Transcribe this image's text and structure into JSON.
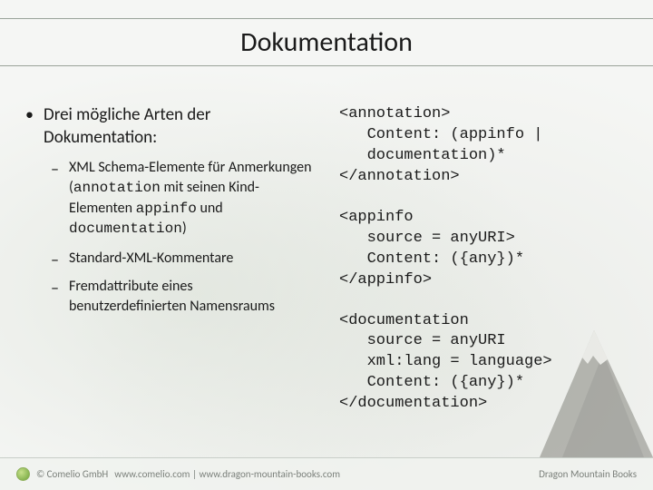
{
  "title": "Dokumentation",
  "left": {
    "main_item": "Drei mögliche Arten der Dokumentation:",
    "sub_items": [
      {
        "prefix": "XML Schema-Elemente für Anmerkungen (",
        "mono1": "annotation",
        "mid1": " mit seinen Kind-Elementen ",
        "mono2": "appinfo",
        "mid2": " und ",
        "mono3": "documentation",
        "suffix": ")"
      },
      {
        "text": "Standard-XML-Kommentare"
      },
      {
        "text": "Fremdattribute eines benutzerdefinierten Namensraums"
      }
    ]
  },
  "code": {
    "block1": "<annotation>\n   Content: (appinfo |\n   documentation)*\n</annotation>",
    "block2": "<appinfo\n   source = anyURI>\n   Content: ({any})*\n</appinfo>",
    "block3": "<documentation\n   source = anyURI\n   xml:lang = language>\n   Content: ({any})*\n</documentation>"
  },
  "footer": {
    "copyright": "© Comelio GmbH",
    "url": "www.comelio.com | www.dragon-mountain-books.com",
    "right": "Dragon Mountain Books"
  }
}
